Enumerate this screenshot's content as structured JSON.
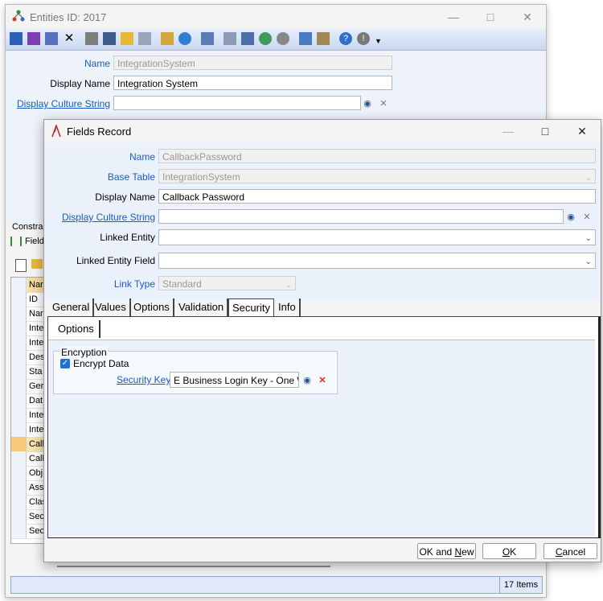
{
  "back_window": {
    "title": "Entities ID: 2017",
    "form": {
      "name_label": "Name",
      "name_value": "IntegrationSystem",
      "display_name_label": "Display Name",
      "display_name_value": "Integration System",
      "display_culture_label": "Display Culture String",
      "display_culture_value": ""
    },
    "constraints_label": "Constra",
    "fields_label": "Field",
    "grid_header": "Nar",
    "grid_rows": [
      "ID",
      "Nar",
      "Inte",
      "Inte",
      "Des",
      "Sta",
      "Ger",
      "Dat",
      "Inte",
      "Inte",
      "Call",
      "Call",
      "Obj",
      "Ass",
      "Clas",
      "Sec",
      "Sec"
    ],
    "status_count": "17 Items"
  },
  "front_window": {
    "title": "Fields  Record",
    "form": {
      "name_label": "Name",
      "name_value": "CallbackPassword",
      "base_table_label": "Base Table",
      "base_table_value": "IntegrationSystem",
      "display_name_label": "Display Name",
      "display_name_value": "Callback Password",
      "display_culture_label": "Display Culture String",
      "display_culture_value": "",
      "linked_entity_label": "Linked Entity",
      "linked_entity_value": "",
      "linked_entity_field_label": "Linked Entity Field",
      "linked_entity_field_value": "",
      "link_type_label": "Link Type",
      "link_type_value": "Standard"
    },
    "tabs": [
      "General",
      "Values",
      "Options",
      "Validation",
      "Security",
      "Info"
    ],
    "active_tab": "Security",
    "subtab": "Options",
    "encryption": {
      "group_label": "Encryption",
      "encrypt_data_label": "Encrypt Data",
      "encrypt_data_checked": true,
      "security_key_label": "Security Key",
      "security_key_value": "E Business Login Key - One W"
    },
    "buttons": {
      "ok_and_new": "OK and New",
      "ok": "OK",
      "cancel": "Cancel"
    }
  },
  "colors": {
    "link": "#1d5bbf",
    "checkbox": "#1e6fd9",
    "toolbar_bg": "#c9d8f0",
    "form_bg": "#eaf1fb"
  }
}
